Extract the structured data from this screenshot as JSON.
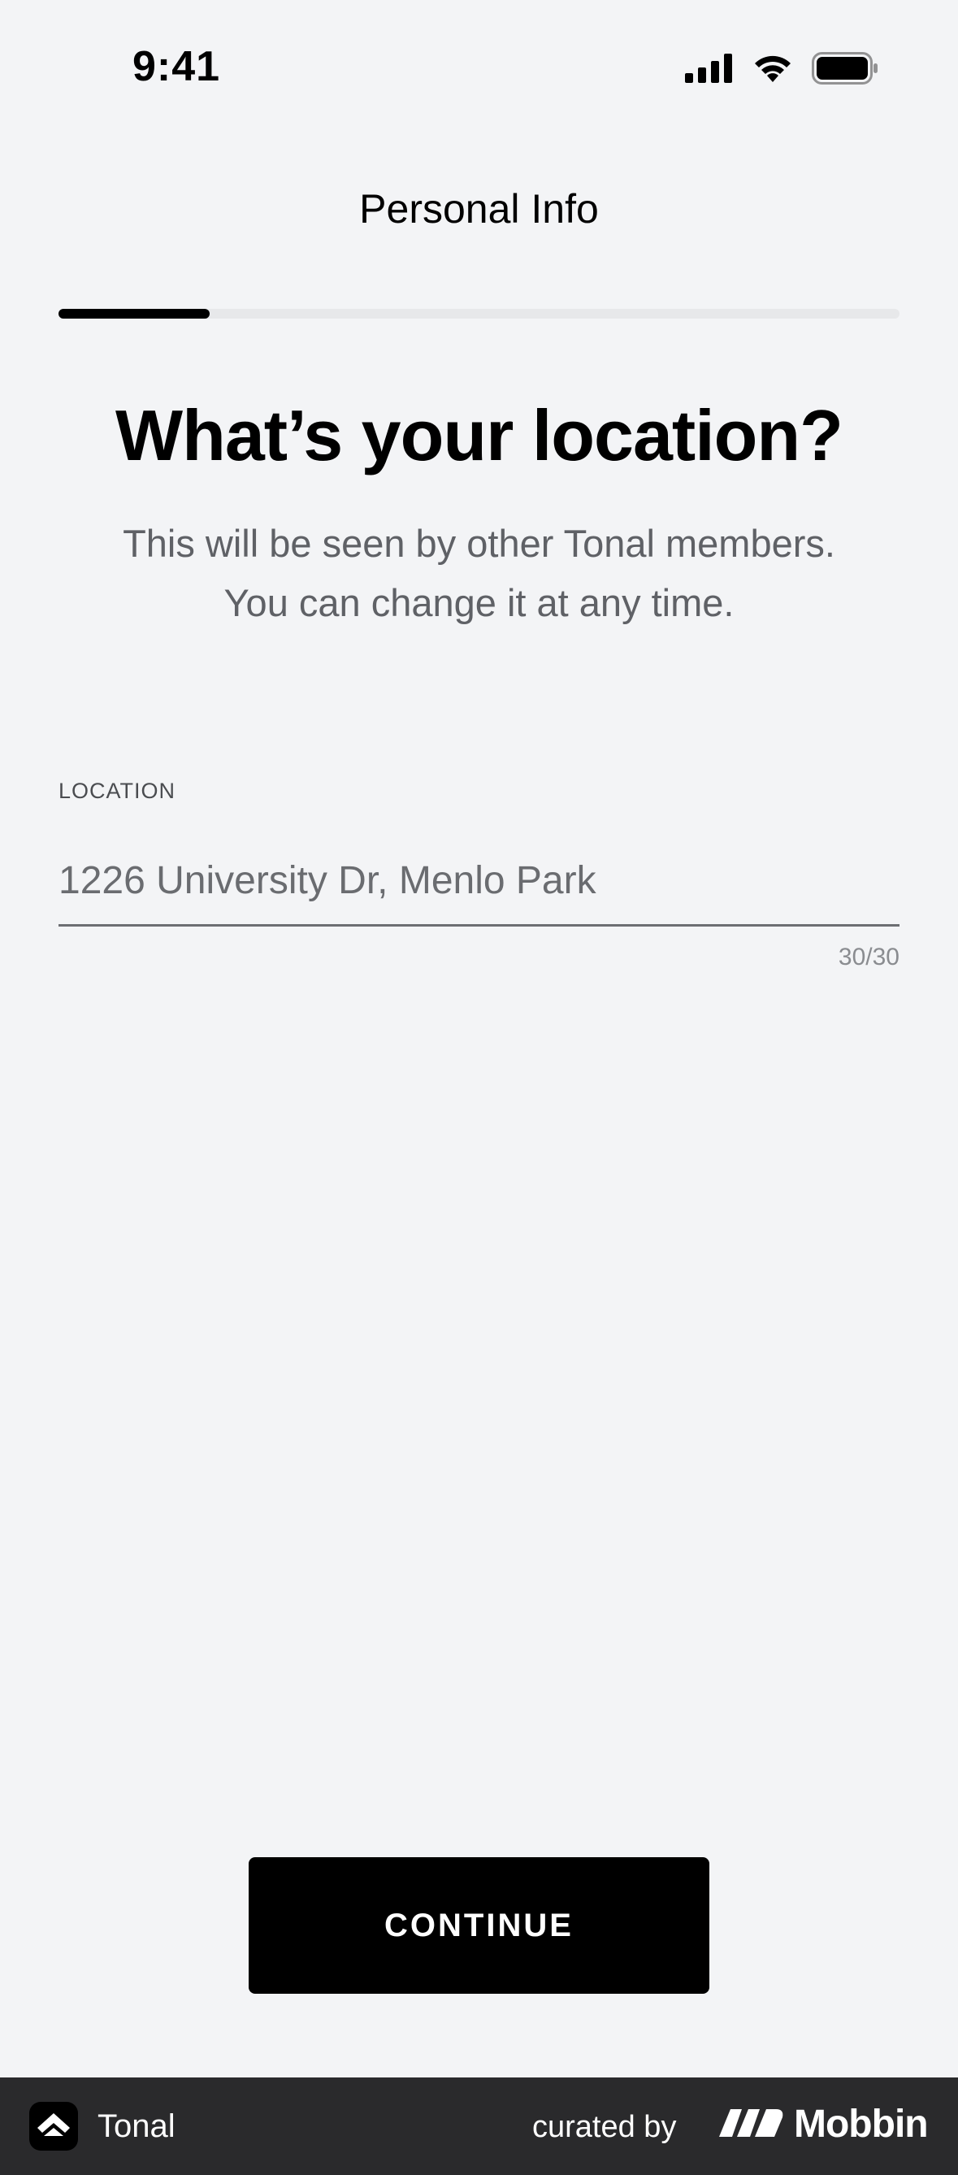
{
  "status_bar": {
    "time": "9:41",
    "icons": [
      "cellular-signal-icon",
      "wifi-icon",
      "battery-icon"
    ]
  },
  "header": {
    "title": "Personal Info"
  },
  "progress": {
    "value": 0.18
  },
  "main": {
    "heading": "What’s your location?",
    "subtitle_line1": "This will be seen by other Tonal members.",
    "subtitle_line2": "You can change it at any time."
  },
  "location_field": {
    "label": "LOCATION",
    "value": "1226 University Dr, Menlo Park",
    "counter": "30/30"
  },
  "actions": {
    "continue_label": "CONTINUE"
  },
  "footer": {
    "app_name": "Tonal",
    "curated_by": "curated by",
    "brand": "Mobbin"
  },
  "colors": {
    "background": "#f3f4f6",
    "primary_button": "#000000",
    "progress_fill": "#000000",
    "footer_background": "#2a2a2c"
  }
}
